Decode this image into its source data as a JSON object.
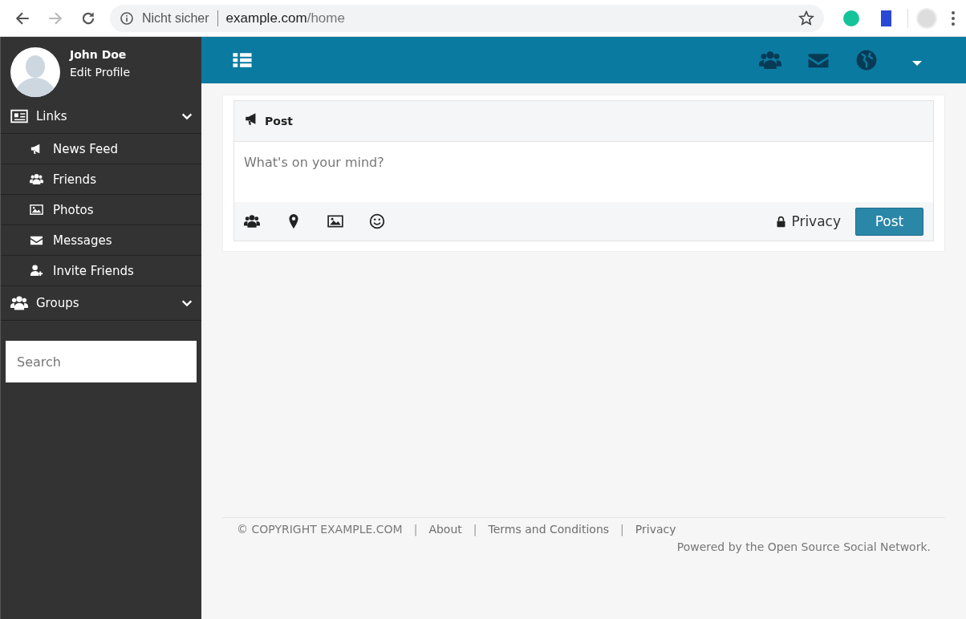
{
  "browser": {
    "security_label": "Nicht sicher",
    "url_host": "example.com",
    "url_path": "/home",
    "forward_disabled": true
  },
  "profile": {
    "name": "John Doe",
    "action": "Edit Profile"
  },
  "sidebar": {
    "sections": [
      {
        "label": "Links",
        "children": [
          {
            "label": "News Feed"
          },
          {
            "label": "Friends"
          },
          {
            "label": "Photos"
          },
          {
            "label": "Messages"
          },
          {
            "label": "Invite Friends"
          }
        ]
      },
      {
        "label": "Groups"
      }
    ],
    "search": {
      "placeholder": "Search"
    }
  },
  "composer": {
    "title": "Post",
    "placeholder": "What's on your mind?",
    "privacy": "Privacy",
    "submit": "Post"
  },
  "footer": {
    "items": [
      {
        "kind": "text",
        "text": "© COPYRIGHT EXAMPLE.COM"
      },
      {
        "kind": "separator",
        "text": "|"
      },
      {
        "kind": "link",
        "text": "About"
      },
      {
        "kind": "separator",
        "text": "|"
      },
      {
        "kind": "link",
        "text": "Terms and Conditions"
      },
      {
        "kind": "separator",
        "text": "|"
      },
      {
        "kind": "link",
        "text": "Privacy"
      }
    ],
    "powered": "Powered by the Open Source Social Network."
  }
}
